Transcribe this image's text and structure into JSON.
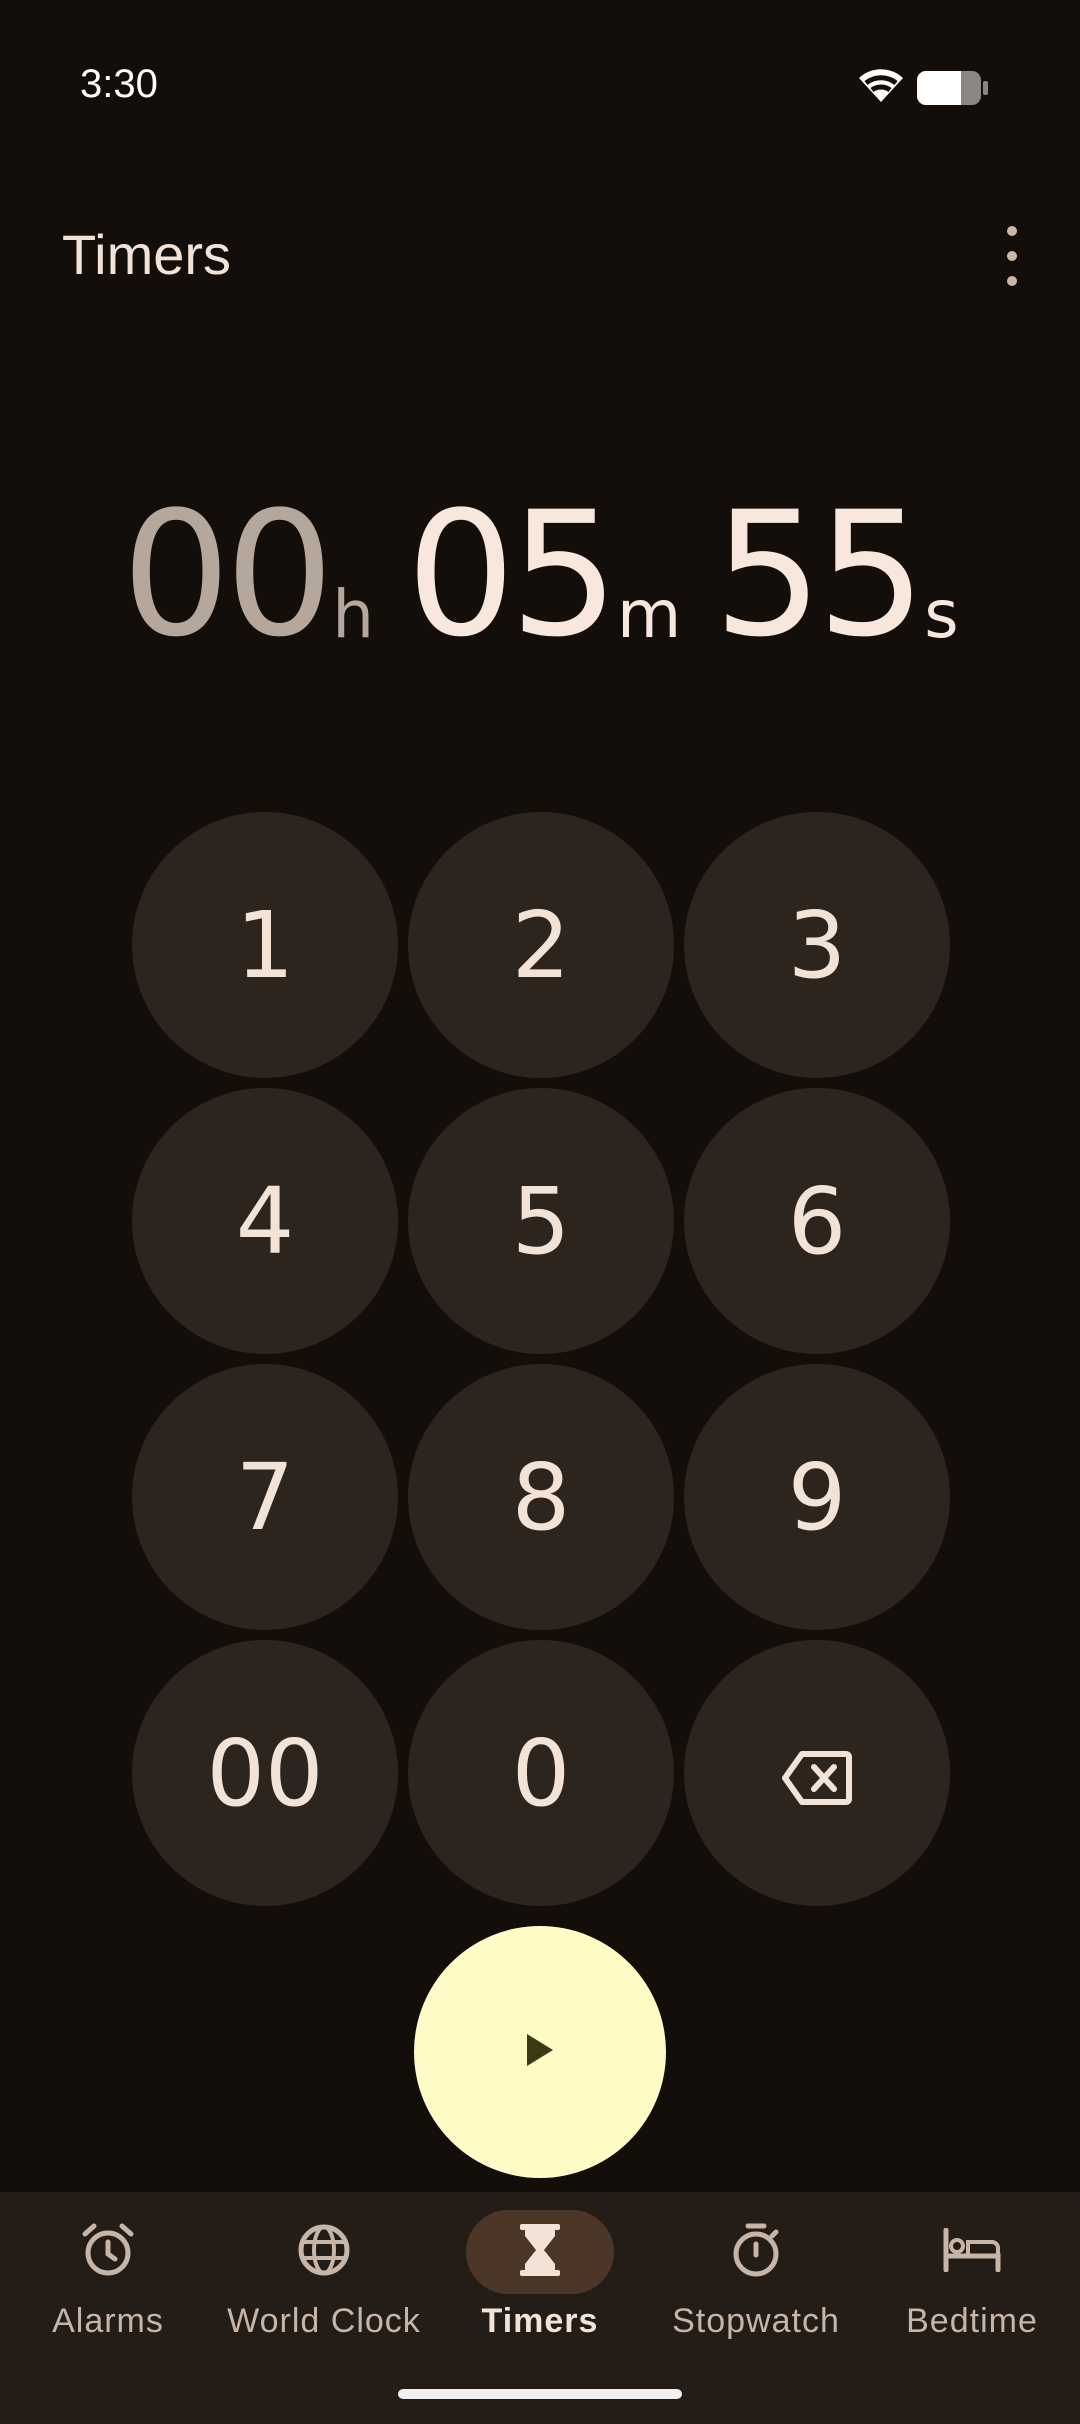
{
  "status_bar": {
    "time": "3:30",
    "icons": [
      "wifi-icon",
      "battery-icon"
    ]
  },
  "app_bar": {
    "title": "Timers",
    "overflow_icon": "more-vert-icon"
  },
  "timer_display": {
    "hours": "00",
    "hours_unit": "h",
    "minutes": "05",
    "minutes_unit": "m",
    "seconds": "55",
    "seconds_unit": "s"
  },
  "keypad": {
    "keys": [
      "1",
      "2",
      "3",
      "4",
      "5",
      "6",
      "7",
      "8",
      "9",
      "00",
      "0"
    ],
    "backspace_icon": "backspace-icon"
  },
  "start_button": {
    "icon": "play-icon"
  },
  "bottom_nav": {
    "items": [
      {
        "label": "Alarms",
        "icon": "alarm-icon",
        "active": false
      },
      {
        "label": "World Clock",
        "icon": "globe-icon",
        "active": false
      },
      {
        "label": "Timers",
        "icon": "hourglass-icon",
        "active": true
      },
      {
        "label": "Stopwatch",
        "icon": "stopwatch-icon",
        "active": false
      },
      {
        "label": "Bedtime",
        "icon": "bed-icon",
        "active": false
      }
    ]
  },
  "colors": {
    "background": "#130e0a",
    "key_fill": "#2d241d",
    "start_fill": "#fefbc6",
    "nav_background": "#241c16",
    "nav_active_pill": "#4b3627"
  }
}
